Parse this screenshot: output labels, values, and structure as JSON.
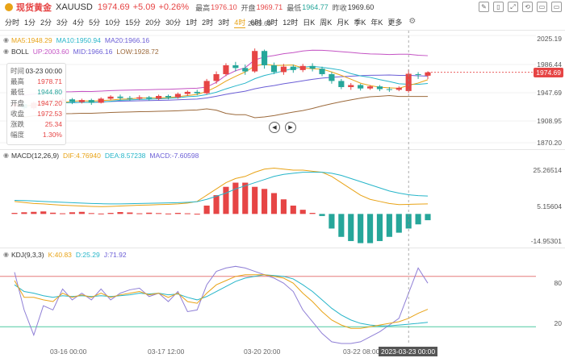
{
  "header": {
    "name": "现货黄金",
    "symbol": "XAUUSD",
    "price": "1974.69",
    "change": "+5.09",
    "change_pct": "+0.26%",
    "high_label": "最高",
    "high": "1976.10",
    "open_label": "开盘",
    "open": "1969.71",
    "low_label": "最低",
    "low": "1964.77",
    "prev_label": "昨收",
    "prev": "1969.60"
  },
  "periods": [
    "分时",
    "1分",
    "2分",
    "3分",
    "4分",
    "5分",
    "10分",
    "15分",
    "20分",
    "30分",
    "1时",
    "2时",
    "3时",
    "4时",
    "6时",
    "8时",
    "12时",
    "日K",
    "周K",
    "月K",
    "季K",
    "年K",
    "更多"
  ],
  "active_period": "4时",
  "tools": [
    "✎",
    "▯",
    "⤢",
    "⟲",
    "▭",
    "▭"
  ],
  "main_legend": {
    "ma5": "MA5:1948.29",
    "ma10": "MA10:1950.94",
    "ma20": "MA20:1966.16",
    "boll": "BOLL",
    "up": "UP:2003.60",
    "mid": "MID:1966.16",
    "low": "LOW:1928.72"
  },
  "macd_legend": {
    "title": "MACD(12,26,9)",
    "dif": "DIF:4.76940",
    "dea": "DEA:8.57238",
    "macd": "MACD:-7.60598"
  },
  "kdj_legend": {
    "title": "KDJ(9,3,3)",
    "k": "K:40.83",
    "d": "D:25.29",
    "j": "J:71.92"
  },
  "info": {
    "rows": [
      {
        "k": "时间",
        "v": "03-23 00:00"
      },
      {
        "k": "最高",
        "v": "1978.71"
      },
      {
        "k": "最低",
        "v": "1944.80"
      },
      {
        "k": "开盘",
        "v": "1947.20"
      },
      {
        "k": "收盘",
        "v": "1972.53"
      },
      {
        "k": "涨跌",
        "v": "25.34"
      },
      {
        "k": "幅度",
        "v": "1.30%"
      }
    ]
  },
  "y_axis_main": [
    "2025.19",
    "1986.44",
    "1947.69",
    "1908.95",
    "1870.20"
  ],
  "current_price_tag": "1974.69",
  "peak_label": "2009.69",
  "y_axis_macd": [
    "25.26514",
    "5.15604",
    "-14.95301"
  ],
  "y_axis_kdj": [
    "80",
    "20"
  ],
  "x_axis": [
    "03-16 00:00",
    "03-17 12:00",
    "03-20 20:00",
    "03-22 08:00"
  ],
  "x_axis_current": "2023-03-23 00:00",
  "colors": {
    "up": "#e64545",
    "down": "#26a69a",
    "accent": "#e8a317"
  },
  "chart_data": {
    "type": "candlestick",
    "y_range": [
      1870.2,
      2025.19
    ],
    "candles": [
      [
        1925,
        1928,
        1918,
        1930
      ],
      [
        1928,
        1922,
        1919,
        1931
      ],
      [
        1922,
        1930,
        1920,
        1932
      ],
      [
        1930,
        1933,
        1928,
        1936
      ],
      [
        1933,
        1932,
        1929,
        1936
      ],
      [
        1932,
        1935,
        1930,
        1938
      ],
      [
        1935,
        1931,
        1928,
        1937
      ],
      [
        1931,
        1934,
        1929,
        1936
      ],
      [
        1934,
        1930,
        1927,
        1936
      ],
      [
        1930,
        1936,
        1929,
        1938
      ],
      [
        1936,
        1939,
        1934,
        1941
      ],
      [
        1939,
        1937,
        1934,
        1942
      ],
      [
        1937,
        1936,
        1933,
        1940
      ],
      [
        1936,
        1938,
        1934,
        1941
      ],
      [
        1938,
        1936,
        1933,
        1940
      ],
      [
        1936,
        1940,
        1934,
        1942
      ],
      [
        1940,
        1938,
        1935,
        1942
      ],
      [
        1938,
        1943,
        1936,
        1945
      ],
      [
        1943,
        1946,
        1940,
        1948
      ],
      [
        1946,
        1944,
        1941,
        1949
      ],
      [
        1944,
        1962,
        1942,
        1965
      ],
      [
        1962,
        1972,
        1958,
        1976
      ],
      [
        1972,
        1985,
        1969,
        1988
      ],
      [
        1985,
        1981,
        1976,
        1990
      ],
      [
        1981,
        1976,
        1971,
        1986
      ],
      [
        1976,
        2006,
        1974,
        2009.69
      ],
      [
        2006,
        1985,
        1980,
        2008
      ],
      [
        1985,
        1975,
        1972,
        1989
      ],
      [
        1975,
        1983,
        1971,
        1987
      ],
      [
        1983,
        1978,
        1974,
        1986
      ],
      [
        1978,
        1984,
        1975,
        1987
      ],
      [
        1984,
        1980,
        1976,
        1988
      ],
      [
        1980,
        1972,
        1969,
        1983
      ],
      [
        1972,
        1962,
        1958,
        1975
      ],
      [
        1962,
        1953,
        1950,
        1965
      ],
      [
        1953,
        1956,
        1949,
        1959
      ],
      [
        1956,
        1951,
        1948,
        1958
      ],
      [
        1951,
        1954,
        1949,
        1956
      ],
      [
        1954,
        1950,
        1947,
        1956
      ],
      [
        1950,
        1949,
        1946,
        1953
      ],
      [
        1949,
        1952,
        1947,
        1954
      ],
      [
        1947.2,
        1972.53,
        1944.8,
        1978.71
      ],
      [
        1972,
        1971,
        1965,
        1975
      ],
      [
        1969.71,
        1974.69,
        1964.77,
        1976.1
      ]
    ],
    "macd_range": [
      -14.95301,
      25.26514
    ],
    "macd_hist": [
      0.5,
      0.8,
      1.0,
      1.2,
      0.6,
      0.3,
      0.8,
      1.0,
      0.4,
      0.2,
      0.5,
      0.9,
      0.7,
      0.3,
      0.6,
      0.4,
      0.2,
      0.5,
      0.3,
      0.1,
      4,
      9,
      13,
      15,
      15,
      13,
      12,
      10,
      7,
      4,
      2,
      0.5,
      -1,
      -7,
      -11,
      -13,
      -14,
      -14,
      -13,
      -11,
      -9,
      -7,
      -5,
      -3
    ],
    "macd_dif": [
      6,
      5.5,
      5,
      4.8,
      4.5,
      4.2,
      4,
      3.8,
      3.6,
      3.5,
      3.6,
      3.8,
      4,
      4.2,
      4.3,
      4.5,
      4.6,
      4.8,
      5.2,
      6,
      9,
      12,
      15,
      17,
      18,
      20,
      21.5,
      22,
      21.5,
      21,
      21,
      20.5,
      20,
      18,
      15,
      12,
      9,
      7,
      6,
      5,
      4.5,
      4.6,
      4.7,
      4.8
    ],
    "macd_dea": [
      6.5,
      6.4,
      6.2,
      6,
      5.8,
      5.6,
      5.4,
      5.2,
      5,
      4.9,
      4.8,
      4.8,
      4.9,
      5,
      5.1,
      5.2,
      5.3,
      5.4,
      5.6,
      5.9,
      7,
      8.5,
      10,
      12,
      13.5,
      15,
      16.5,
      18,
      19,
      19.5,
      20,
      20,
      20,
      19.5,
      18.5,
      17,
      15.5,
      14,
      12.5,
      11,
      10,
      9.2,
      8.8,
      8.57
    ],
    "kdj_k": [
      75,
      55,
      55,
      52,
      50,
      60,
      55,
      58,
      55,
      60,
      55,
      58,
      60,
      62,
      58,
      60,
      55,
      60,
      50,
      48,
      60,
      70,
      75,
      80,
      82,
      82,
      82,
      80,
      78,
      72,
      60,
      50,
      38,
      28,
      22,
      18,
      18,
      20,
      22,
      24,
      26,
      30,
      36,
      40.83
    ],
    "kdj_d": [
      70,
      62,
      60,
      57,
      55,
      57,
      56,
      57,
      56,
      57,
      56,
      57,
      58,
      60,
      59,
      60,
      58,
      59,
      55,
      52,
      56,
      62,
      68,
      74,
      78,
      80,
      82,
      81,
      80,
      77,
      70,
      62,
      52,
      42,
      34,
      28,
      24,
      22,
      21,
      21,
      22,
      23,
      24,
      25.29
    ],
    "kdj_j": [
      85,
      40,
      10,
      45,
      40,
      65,
      52,
      60,
      52,
      65,
      52,
      60,
      64,
      66,
      56,
      60,
      50,
      62,
      38,
      40,
      70,
      86,
      90,
      92,
      90,
      86,
      82,
      78,
      72,
      62,
      40,
      26,
      12,
      2,
      0,
      0,
      2,
      8,
      14,
      22,
      30,
      60,
      90,
      71.92
    ],
    "kdj_range": [
      0,
      100
    ]
  }
}
